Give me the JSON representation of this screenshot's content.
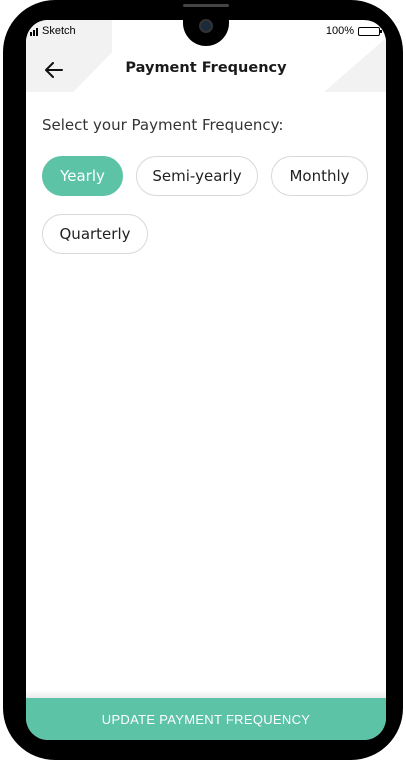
{
  "status_bar": {
    "carrier": "Sketch",
    "battery": "100%"
  },
  "header": {
    "title": "Payment Frequency",
    "back_icon": "arrow-left-icon"
  },
  "prompt": "Select your Payment Frequency:",
  "frequency_options": [
    {
      "label": "Yearly",
      "selected": true
    },
    {
      "label": "Semi-yearly",
      "selected": false
    },
    {
      "label": "Monthly",
      "selected": false
    },
    {
      "label": "Quarterly",
      "selected": false
    }
  ],
  "update_button": {
    "label": "UPDATE PAYMENT FREQUENCY"
  },
  "colors": {
    "accent": "#5cc3a7",
    "text": "#222222",
    "chip_border": "#d8d8d8"
  }
}
